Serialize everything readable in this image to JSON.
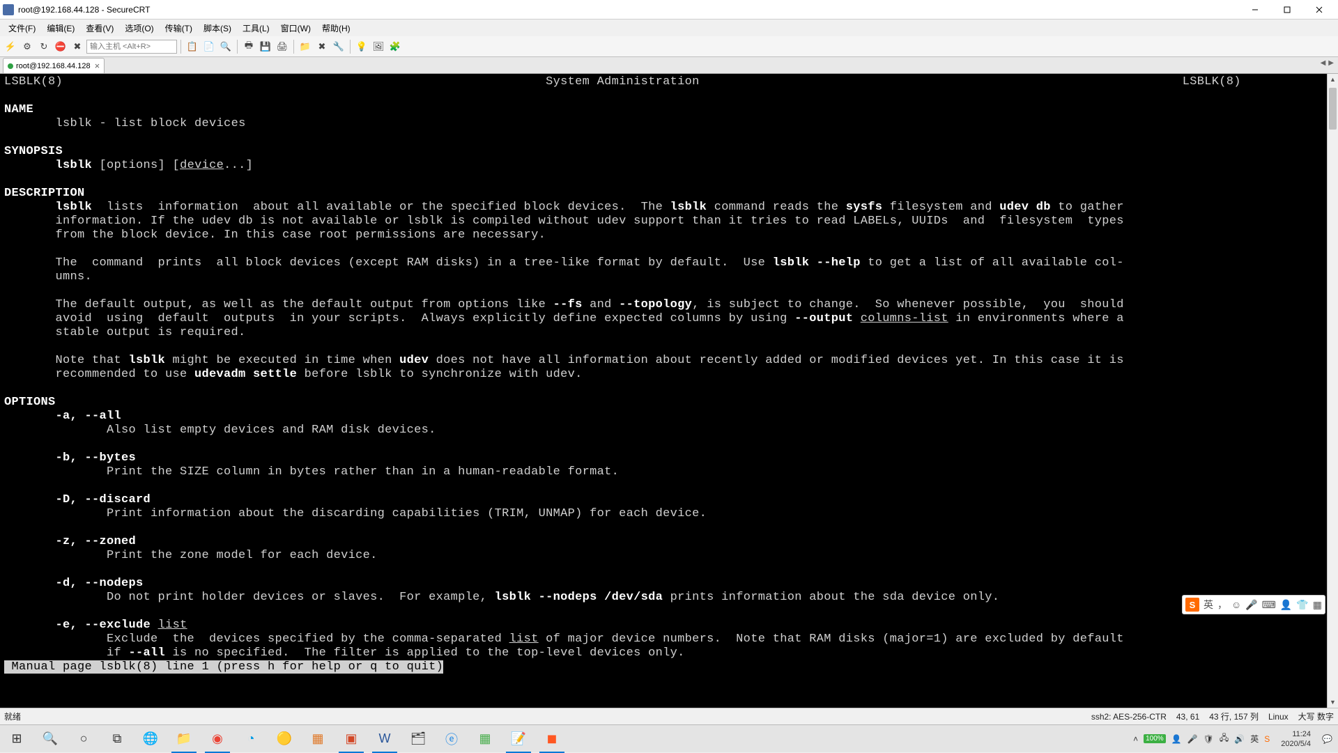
{
  "window": {
    "title": "root@192.168.44.128 - SecureCRT"
  },
  "menu": {
    "items": [
      "文件(F)",
      "编辑(E)",
      "查看(V)",
      "选项(O)",
      "传输(T)",
      "脚本(S)",
      "工具(L)",
      "窗口(W)",
      "帮助(H)"
    ]
  },
  "toolbar": {
    "host_placeholder": "输入主机 <Alt+R>"
  },
  "tab": {
    "label": "root@192.168.44.128"
  },
  "man": {
    "header_left": "LSBLK(8)",
    "header_center": "System Administration",
    "header_right": "LSBLK(8)",
    "sec_name": "NAME",
    "name_line_cmd": "lsblk",
    "name_line_rest": " - list block devices",
    "sec_synopsis": "SYNOPSIS",
    "syn_cmd": "lsblk",
    "syn_mid": " [options] [",
    "syn_device": "device",
    "syn_end": "...]",
    "sec_description": "DESCRIPTION",
    "desc_p1_a": "lsblk",
    "desc_p1_b": "  lists  information  about all available or the specified block devices.  The ",
    "desc_p1_c": "lsblk",
    "desc_p1_d": " command reads the ",
    "desc_p1_e": "sysfs",
    "desc_p1_f": " filesystem and ",
    "desc_p1_g": "udev db",
    "desc_p1_h": " to gather",
    "desc_p1_l2": "       information. If the udev db is not available or lsblk is compiled without udev support than it tries to read LABELs, UUIDs  and  filesystem  types",
    "desc_p1_l3": "       from the block device. In this case root permissions are necessary.",
    "desc_p2_a": "       The  command  prints  all block devices (except RAM disks) in a tree-like format by default.  Use ",
    "desc_p2_b": "lsblk --help",
    "desc_p2_c": " to get a list of all available col-",
    "desc_p2_l2": "       umns.",
    "desc_p3_a": "       The default output, as well as the default output from options like ",
    "desc_p3_b": "--fs",
    "desc_p3_c": " and ",
    "desc_p3_d": "--topology",
    "desc_p3_e": ", is subject to change.  So whenever possible,  you  should",
    "desc_p3_l2a": "       avoid  using  default  outputs  in your scripts.  Always explicitly define expected columns by using ",
    "desc_p3_l2b": "--output",
    "desc_p3_l2c": " ",
    "desc_p3_l2d": "columns-list",
    "desc_p3_l2e": " in environments where a",
    "desc_p3_l3": "       stable output is required.",
    "desc_p4_a": "       Note that ",
    "desc_p4_b": "lsblk",
    "desc_p4_c": " might be executed in time when ",
    "desc_p4_d": "udev",
    "desc_p4_e": " does not have all information about recently added or modified devices yet. In this case it is",
    "desc_p4_l2a": "       recommended to use ",
    "desc_p4_l2b": "udevadm settle",
    "desc_p4_l2c": " before lsblk to synchronize with udev.",
    "sec_options": "OPTIONS",
    "opt_a": "-a, --all",
    "opt_a_desc": "              Also list empty devices and RAM disk devices.",
    "opt_b": "-b, --bytes",
    "opt_b_desc": "              Print the SIZE column in bytes rather than in a human-readable format.",
    "opt_D": "-D, --discard",
    "opt_D_desc": "              Print information about the discarding capabilities (TRIM, UNMAP) for each device.",
    "opt_z": "-z, --zoned",
    "opt_z_desc": "              Print the zone model for each device.",
    "opt_d": "-d, --nodeps",
    "opt_d_desc_a": "              Do not print holder devices or slaves.  For example, ",
    "opt_d_desc_b": "lsblk --nodeps /dev/sda",
    "opt_d_desc_c": " prints information about the sda device only.",
    "opt_e_a": "-e, --exclude",
    "opt_e_b": " ",
    "opt_e_c": "list",
    "opt_e_desc_a": "              Exclude  the  devices specified by the comma-separated ",
    "opt_e_desc_b": "list",
    "opt_e_desc_c": " of major device numbers.  Note that RAM disks (major=1) are excluded by default",
    "opt_e_l2a": "              if ",
    "opt_e_l2b": "--all",
    "opt_e_l2c": " is no specified.  The filter is applied to the top-level devices only.",
    "footer": " Manual page lsblk(8) line 1 (press h for help or q to quit)"
  },
  "status": {
    "ready": "就绪",
    "proto": "ssh2: AES-256-CTR",
    "pos": "43, 61",
    "size": "43 行, 157 列",
    "encoding": "Linux",
    "caps": "大写 数字"
  },
  "ime": {
    "lang": "英"
  },
  "tray": {
    "battery": "100%",
    "time": "11:24",
    "date": "2020/5/4"
  }
}
